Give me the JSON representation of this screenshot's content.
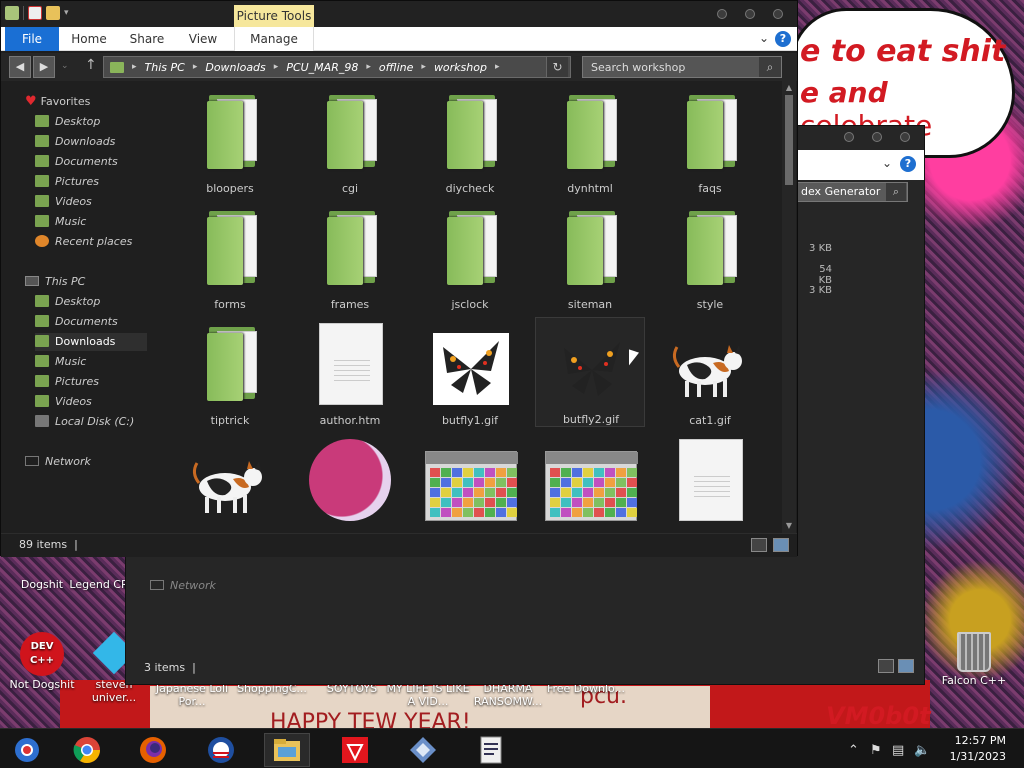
{
  "desktop": {
    "bubble_text_1": "e to eat shit",
    "bubble_text_2_bold": "e and",
    "bubble_text_2_rest": " celebrate",
    "strip_text_1": "pcu.",
    "strip_text_2": "HAPPY TEW YEAR!",
    "vm_text": "VM0b0t",
    "icons": [
      {
        "label": "Dogshit"
      },
      {
        "label": "Legend CRYAI"
      },
      {
        "label": "Not Dogshit"
      },
      {
        "label": "steven univer..."
      },
      {
        "label": "Japanese Loli Por..."
      },
      {
        "label": "ShoppingC..."
      },
      {
        "label": "SOYTOYS"
      },
      {
        "label": "MY LIFE IS LIKE A VID..."
      },
      {
        "label": "DHARMA RANSOMW..."
      },
      {
        "label": "Free Downlo..."
      },
      {
        "label": "Falcon C++"
      }
    ],
    "devcpp_label": "DEV C++"
  },
  "back_window": {
    "search_placeholder": "dex Generator",
    "sizes": [
      "3 KB",
      "54 KB",
      "3 KB"
    ],
    "network_label": "Network",
    "status": "3 items"
  },
  "explorer": {
    "context_tab": "Picture Tools",
    "ribbon_tabs": [
      "File",
      "Home",
      "Share",
      "View",
      "Manage"
    ],
    "help": "?",
    "breadcrumb": [
      "This PC",
      "Downloads",
      "PCU_MAR_98",
      "offline",
      "workshop"
    ],
    "search_placeholder": "Search workshop",
    "nav": {
      "favorites_header": "Favorites",
      "favorites": [
        "Desktop",
        "Downloads",
        "Documents",
        "Pictures",
        "Videos",
        "Music",
        "Recent places"
      ],
      "thispc_header": "This PC",
      "thispc": [
        "Desktop",
        "Documents",
        "Downloads",
        "Music",
        "Pictures",
        "Videos",
        "Local Disk (C:)"
      ],
      "network": "Network",
      "selected": "Downloads"
    },
    "items": [
      {
        "name": "bloopers",
        "type": "folder"
      },
      {
        "name": "cgi",
        "type": "folder"
      },
      {
        "name": "diycheck",
        "type": "folder"
      },
      {
        "name": "dynhtml",
        "type": "folder"
      },
      {
        "name": "faqs",
        "type": "folder"
      },
      {
        "name": "forms",
        "type": "folder"
      },
      {
        "name": "frames",
        "type": "folder"
      },
      {
        "name": "jsclock",
        "type": "folder"
      },
      {
        "name": "siteman",
        "type": "folder"
      },
      {
        "name": "style",
        "type": "folder"
      },
      {
        "name": "tiptrick",
        "type": "folder"
      },
      {
        "name": "author.htm",
        "type": "document"
      },
      {
        "name": "butfly1.gif",
        "type": "butterfly"
      },
      {
        "name": "butfly2.gif",
        "type": "butterfly-dark"
      },
      {
        "name": "cat1.gif",
        "type": "cat"
      },
      {
        "name": "",
        "type": "cat"
      },
      {
        "name": "",
        "type": "circle"
      },
      {
        "name": "",
        "type": "table"
      },
      {
        "name": "",
        "type": "table"
      },
      {
        "name": "",
        "type": "document"
      }
    ],
    "status_count": "89 items"
  },
  "taskbar": {
    "apps": [
      "chrome-alt-icon",
      "chrome-icon",
      "firefox-icon",
      "obama-icon",
      "file-explorer-icon",
      "red-app-icon",
      "dev-tool-icon",
      "document-icon"
    ],
    "time": "12:57 PM",
    "date": "1/31/2023"
  }
}
